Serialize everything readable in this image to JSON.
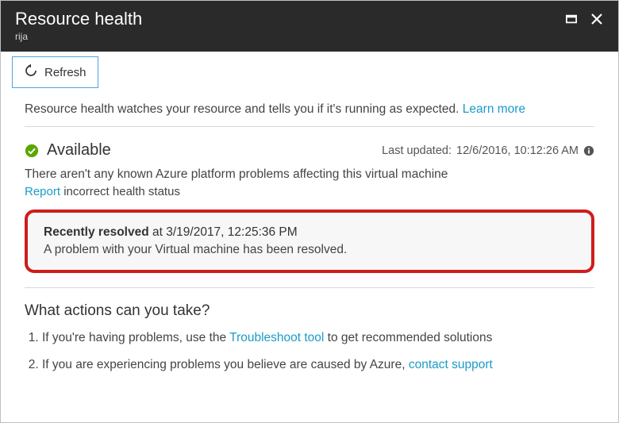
{
  "header": {
    "title": "Resource health",
    "subtitle": "rija"
  },
  "toolbar": {
    "refresh_label": "Refresh"
  },
  "intro": {
    "text": "Resource health watches your resource and tells you if it's running as expected. ",
    "learn_more": "Learn more"
  },
  "status": {
    "state": "Available",
    "last_updated_label": "Last updated: ",
    "last_updated_value": "12/6/2016, 10:12:26 AM",
    "description": "There aren't any known Azure platform problems affecting this virtual machine",
    "report_link": "Report",
    "report_rest": " incorrect health status"
  },
  "resolved": {
    "prefix_bold": "Recently resolved",
    "prefix_rest": " at 3/19/2017, 12:25:36 PM",
    "message": "A problem with your Virtual machine has been resolved."
  },
  "actions": {
    "heading": "What actions can you take?",
    "item1_pre": "If you're having problems, use the ",
    "item1_link": "Troubleshoot tool",
    "item1_post": " to get recommended solutions",
    "item2_pre": "If you are experiencing problems you believe are caused by Azure, ",
    "item2_link": "contact support"
  }
}
